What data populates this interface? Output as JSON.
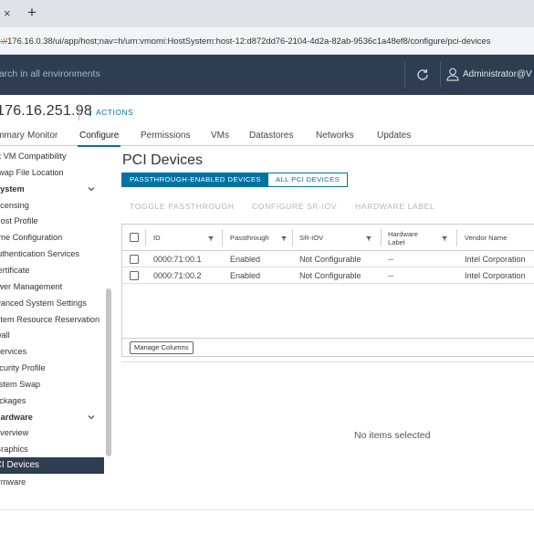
{
  "browser": {
    "close_glyph": "×",
    "newtab_glyph": "+",
    "url_scheme": "https://",
    "url_rest": "176.16.0.38/ui/app/host;nav=h/urn:vmomi:HostSystem:host-12:d872dd76-2104-4d2a-82ab-9536c1a48ef8/configure/pci-devices"
  },
  "header": {
    "search_placeholder": "Search in all environments",
    "user": "Administrator@V",
    "icons": [
      "refresh-icon",
      "user-icon"
    ]
  },
  "host": {
    "title": "176.16.251.98",
    "actions_label": "ACTIONS"
  },
  "main_tabs": [
    "Summary",
    "Monitor",
    "Configure",
    "Permissions",
    "VMs",
    "Datastores",
    "Networks",
    "Updates"
  ],
  "active_tab": "Configure",
  "sidebar": {
    "items": [
      {
        "label": "Default VM Compatibility",
        "style": "normal"
      },
      {
        "label": "Swap File Location",
        "style": "normal"
      },
      {
        "label": "System",
        "style": "group"
      },
      {
        "label": "Licensing",
        "style": "normal"
      },
      {
        "label": "Host Profile",
        "style": "normal"
      },
      {
        "label": "Time Configuration",
        "style": "normal"
      },
      {
        "label": "Authentication Services",
        "style": "normal"
      },
      {
        "label": "Certificate",
        "style": "normal"
      },
      {
        "label": "Power Management",
        "style": "normal"
      },
      {
        "label": "Advanced System Settings",
        "style": "normal"
      },
      {
        "label": "System Resource Reservation",
        "style": "normal"
      },
      {
        "label": "Firewall",
        "style": "normal"
      },
      {
        "label": "Services",
        "style": "normal"
      },
      {
        "label": "Security Profile",
        "style": "normal"
      },
      {
        "label": "System Swap",
        "style": "normal"
      },
      {
        "label": "Packages",
        "style": "normal"
      },
      {
        "label": "Hardware",
        "style": "group"
      },
      {
        "label": "Overview",
        "style": "normal"
      },
      {
        "label": "Graphics",
        "style": "normal"
      },
      {
        "label": "PCI Devices",
        "style": "active"
      },
      {
        "label": "Firmware",
        "style": "normal"
      }
    ]
  },
  "content": {
    "title": "PCI Devices",
    "segments": [
      "PASSTHROUGH-ENABLED DEVICES",
      "ALL PCI DEVICES"
    ],
    "active_segment": 0,
    "actions": [
      "TOGGLE PASSTHROUGH",
      "CONFIGURE SR-IOV",
      "HARDWARE LABEL"
    ],
    "columns": [
      "ID",
      "Passthrough",
      "SR-IOV",
      "Hardware Label",
      "Vendor Name"
    ],
    "rows": [
      {
        "id": "0000:71:00.1",
        "passthrough": "Enabled",
        "sriov": "Not Configurable",
        "hw_label": "--",
        "vendor": "Intel Corporation"
      },
      {
        "id": "0000:71:00.2",
        "passthrough": "Enabled",
        "sriov": "Not Configurable",
        "hw_label": "--",
        "vendor": "Intel Corporation"
      }
    ],
    "manage_columns": "Manage Columns",
    "empty_message": "No items selected"
  }
}
